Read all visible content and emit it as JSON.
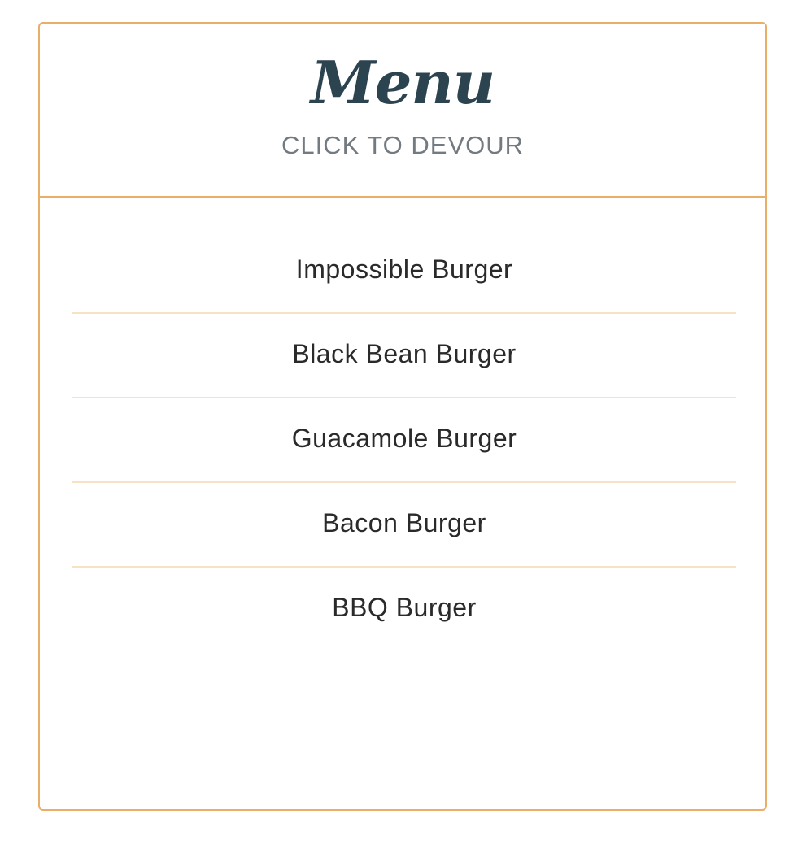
{
  "header": {
    "title": "Menu",
    "subtitle": "CLICK TO DEVOUR"
  },
  "menu": {
    "items": [
      {
        "label": "Impossible Burger"
      },
      {
        "label": "Black Bean Burger"
      },
      {
        "label": "Guacamole Burger"
      },
      {
        "label": "Bacon Burger"
      },
      {
        "label": "BBQ Burger"
      }
    ]
  },
  "colors": {
    "border": "#e9ae68",
    "divider": "#f8e2c5",
    "title": "#2c4350",
    "subtitle": "#737a80",
    "text": "#2a2a2a"
  }
}
